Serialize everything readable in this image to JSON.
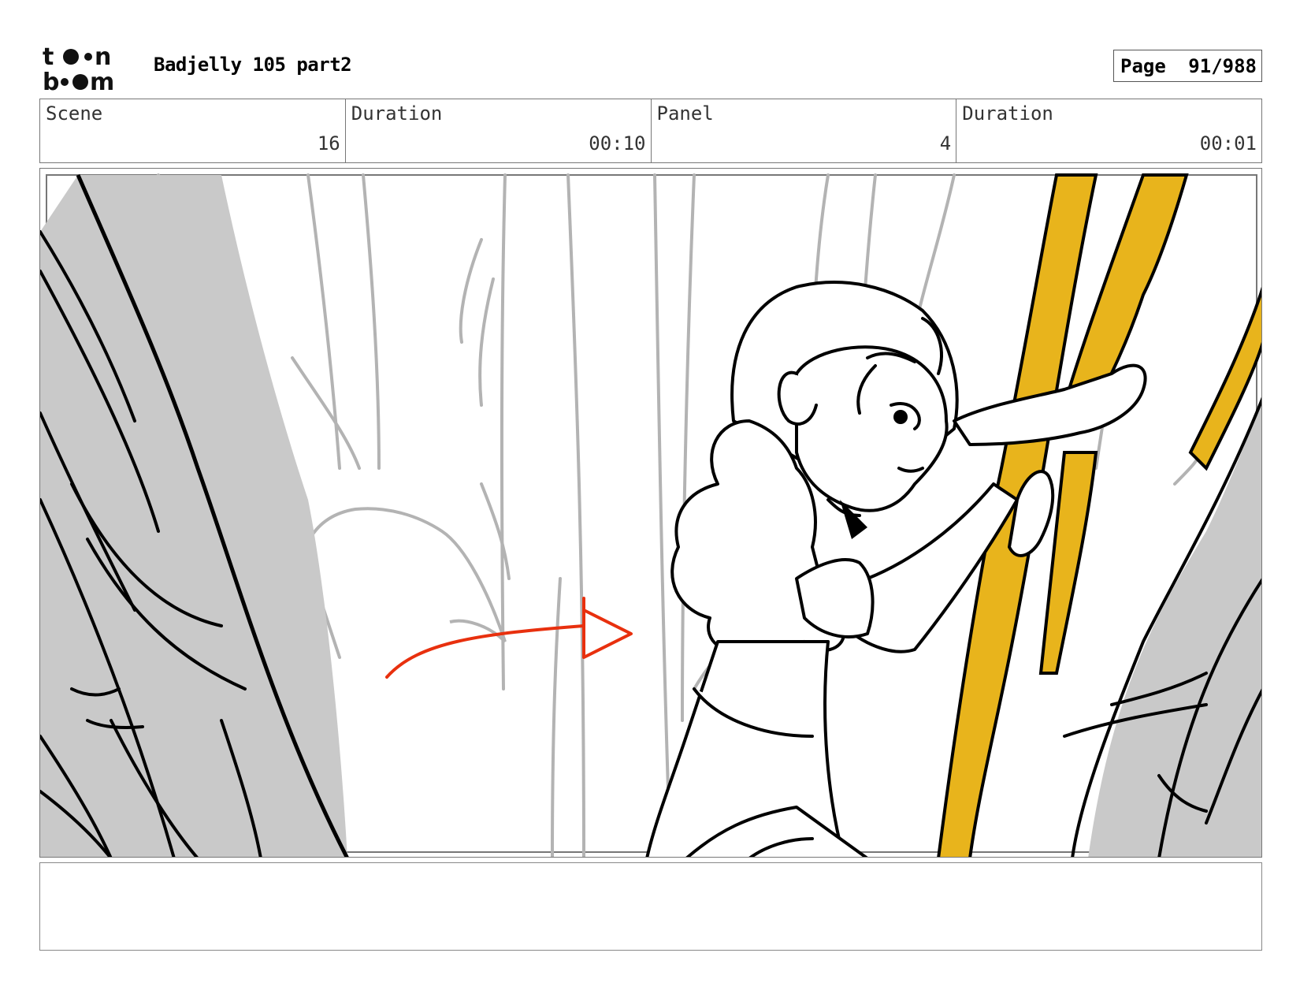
{
  "header": {
    "title": "Badjelly 105 part2",
    "page_label": "Page",
    "page_value": "91/988"
  },
  "logo": {
    "text": "toon boom"
  },
  "info": {
    "scene_label": "Scene",
    "scene_value": "16",
    "duration_label": "Duration",
    "duration_value": "00:10",
    "panel_label": "Panel",
    "panel_value": "4",
    "panel_duration_label": "Duration",
    "panel_duration_value": "00:01"
  },
  "colors": {
    "accent_yellow": "#e8b41c",
    "tree_gray": "#c9c9c9",
    "arrow_red": "#e8300e"
  },
  "notes": {
    "text": ""
  }
}
